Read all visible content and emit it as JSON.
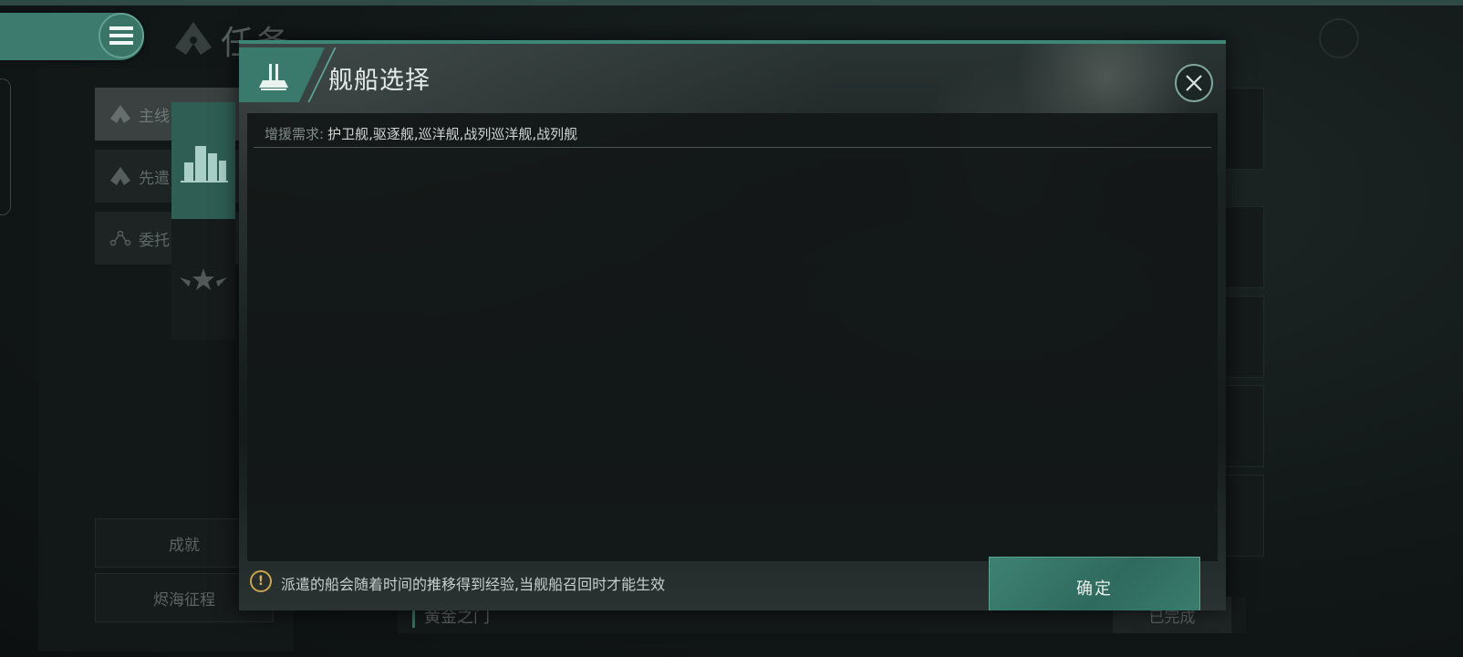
{
  "background": {
    "page_title": "任务",
    "tabs": [
      {
        "label": "主线",
        "active": true
      },
      {
        "label": "先遣",
        "active": false
      },
      {
        "label": "委托",
        "active": false
      }
    ],
    "bottom_buttons": [
      "成就",
      "烬海征程"
    ],
    "task_row": {
      "name": "黄金之门",
      "status": "已完成"
    }
  },
  "modal": {
    "title": "舰船选择",
    "requirement_label": "增援需求:",
    "requirement_value": "护卫舰,驱逐舰,巡洋舰,战列巡洋舰,战列舰",
    "warning_text": "派遣的船会随着时间的推移得到经验,当舰船召回时才能生效",
    "confirm_label": "确定"
  },
  "colors": {
    "accent": "#3a7a6d",
    "warning": "#c9a44a",
    "background": "#0f1414"
  },
  "icons": {
    "menu": "hamburger-icon",
    "logo": "faction-emblem-icon",
    "ship": "ship-icon",
    "close": "close-icon",
    "warning": "exclamation-icon"
  }
}
